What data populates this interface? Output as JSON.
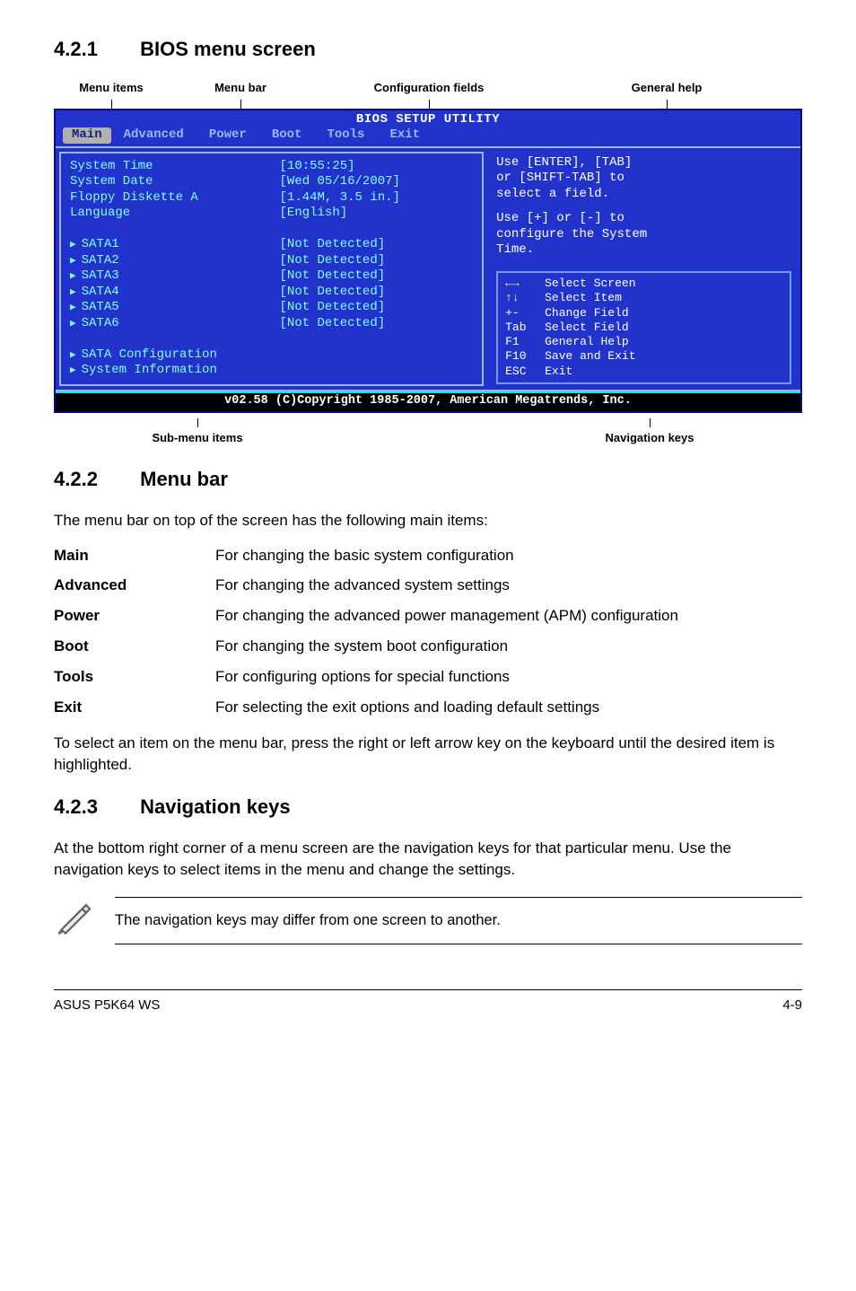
{
  "sections": {
    "s1": {
      "num": "4.2.1",
      "title": "BIOS menu screen"
    },
    "s2": {
      "num": "4.2.2",
      "title": "Menu bar"
    },
    "s3": {
      "num": "4.2.3",
      "title": "Navigation keys"
    }
  },
  "figure": {
    "top_labels": {
      "menu_items": "Menu items",
      "menu_bar": "Menu bar",
      "config_fields": "Configuration fields",
      "general_help": "General help"
    },
    "bottom_labels": {
      "sub_menu": "Sub-menu items",
      "nav_keys": "Navigation keys"
    }
  },
  "bios": {
    "title": "BIOS SETUP UTILITY",
    "tabs": [
      "Main",
      "Advanced",
      "Power",
      "Boot",
      "Tools",
      "Exit"
    ],
    "left_labels": [
      "System Time",
      "System Date",
      "Floppy Diskette A",
      "Language"
    ],
    "left_sub": [
      "SATA1",
      "SATA2",
      "SATA3",
      "SATA4",
      "SATA5",
      "SATA6"
    ],
    "left_sub2": [
      "SATA Configuration",
      "System Information"
    ],
    "right_vals": [
      "[10:55:25]",
      "[Wed 05/16/2007]",
      "[1.44M, 3.5 in.]",
      "[English]"
    ],
    "right_detected": [
      "[Not Detected]",
      "[Not Detected]",
      "[Not Detected]",
      "[Not Detected]",
      "[Not Detected]",
      "[Not Detected]"
    ],
    "help_top": [
      "Use [ENTER], [TAB]",
      "or [SHIFT-TAB] to",
      "select a field."
    ],
    "help_mid": [
      "Use [+] or [-] to",
      "configure the System",
      "Time."
    ],
    "nav": [
      {
        "k": "←→",
        "d": "Select Screen",
        "sym": true
      },
      {
        "k": "↑↓",
        "d": "Select Item",
        "sym": true
      },
      {
        "k": "+-",
        "d": "Change Field",
        "sym": false
      },
      {
        "k": "Tab",
        "d": "Select Field",
        "sym": false
      },
      {
        "k": "F1",
        "d": "General Help",
        "sym": false
      },
      {
        "k": "F10",
        "d": "Save and Exit",
        "sym": false
      },
      {
        "k": "ESC",
        "d": "Exit",
        "sym": false
      }
    ],
    "footer": "v02.58 (C)Copyright 1985-2007, American Megatrends, Inc."
  },
  "menubar_intro": "The menu bar on top of the screen has the following main items:",
  "menubar_items": [
    {
      "term": "Main",
      "desc": "For changing the basic system configuration"
    },
    {
      "term": "Advanced",
      "desc": "For changing the advanced system settings"
    },
    {
      "term": "Power",
      "desc": "For changing the advanced power management (APM) configuration"
    },
    {
      "term": "Boot",
      "desc": "For changing the system boot configuration"
    },
    {
      "term": "Tools",
      "desc": "For configuring options for special functions"
    },
    {
      "term": "Exit",
      "desc": "For selecting the exit options and loading default settings"
    }
  ],
  "menubar_outro": "To select an item on the menu bar, press the right or left arrow key on the keyboard until the desired item is highlighted.",
  "navkeys_para": "At the bottom right corner of a menu screen are the navigation keys for that particular menu. Use the navigation keys to select items in the menu and change the settings.",
  "note_text": "The navigation keys may differ from one screen to another.",
  "footer": {
    "left": "ASUS P5K64 WS",
    "right": "4-9"
  }
}
